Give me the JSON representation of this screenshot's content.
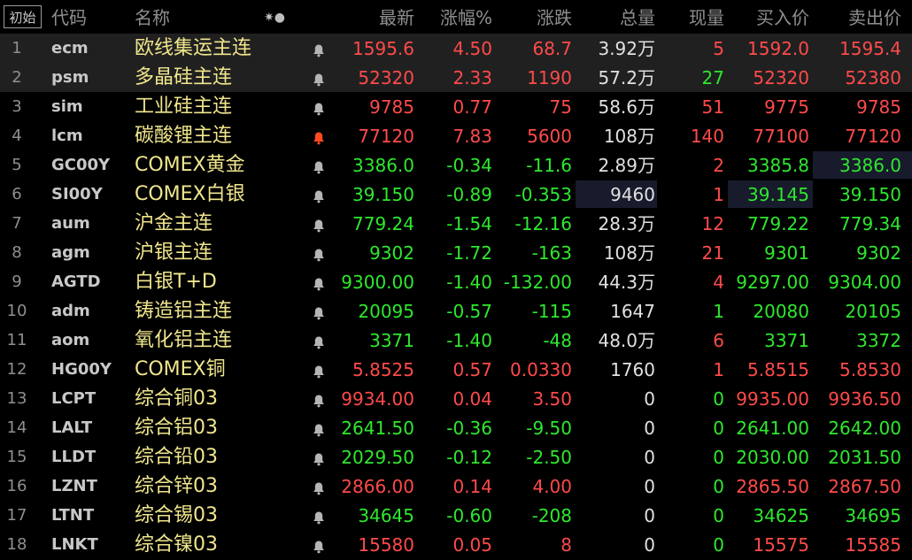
{
  "header": {
    "init_label": "初始",
    "columns": {
      "code": "代码",
      "name": "名称",
      "options_icon": "✷●",
      "last": "最新",
      "pct": "涨幅%",
      "chg": "涨跌",
      "vol": "总量",
      "cur": "现量",
      "bid": "买入价",
      "ask": "卖出价"
    }
  },
  "colors": {
    "up": "#ff4a4a",
    "down": "#2ee82e",
    "name": "#f0e68c",
    "bell_active": "#ff4b1f",
    "bell_inactive": "#b5b5b5"
  },
  "rows": [
    {
      "no": "1",
      "code": "ecm",
      "name": "欧线集运主连",
      "bell": "inactive",
      "last": "1595.6",
      "pct": "4.50",
      "chg": "68.7",
      "vol": "3.92万",
      "cur": "5",
      "bid": "1592.0",
      "ask": "1595.4",
      "dir": "up",
      "hl": true
    },
    {
      "no": "2",
      "code": "psm",
      "name": "多晶硅主连",
      "bell": "inactive",
      "last": "52320",
      "pct": "2.33",
      "chg": "1190",
      "vol": "57.2万",
      "cur": "27",
      "bid": "52320",
      "ask": "52380",
      "dir": "up",
      "cur_dir": "dn",
      "hl": true
    },
    {
      "no": "3",
      "code": "sim",
      "name": "工业硅主连",
      "bell": "inactive",
      "last": "9785",
      "pct": "0.77",
      "chg": "75",
      "vol": "58.6万",
      "cur": "51",
      "bid": "9775",
      "ask": "9785",
      "dir": "up"
    },
    {
      "no": "4",
      "code": "lcm",
      "name": "碳酸锂主连",
      "bell": "active",
      "last": "77120",
      "pct": "7.83",
      "chg": "5600",
      "vol": "108万",
      "cur": "140",
      "bid": "77100",
      "ask": "77120",
      "dir": "up"
    },
    {
      "no": "5",
      "code": "GC00Y",
      "name": "COMEX黄金",
      "bell": "inactive",
      "last": "3386.0",
      "pct": "-0.34",
      "chg": "-11.6",
      "vol": "2.89万",
      "cur": "2",
      "bid": "3385.8",
      "ask": "3386.0",
      "dir": "dn",
      "cur_dir": "up",
      "ask_box": true
    },
    {
      "no": "6",
      "code": "SI00Y",
      "name": "COMEX白银",
      "bell": "inactive",
      "last": "39.150",
      "pct": "-0.89",
      "chg": "-0.353",
      "vol": "9460",
      "cur": "1",
      "bid": "39.145",
      "ask": "39.150",
      "dir": "dn",
      "cur_dir": "up",
      "vol_box": true,
      "bid_box": true
    },
    {
      "no": "7",
      "code": "aum",
      "name": "沪金主连",
      "bell": "inactive",
      "last": "779.24",
      "pct": "-1.54",
      "chg": "-12.16",
      "vol": "28.3万",
      "cur": "12",
      "bid": "779.22",
      "ask": "779.34",
      "dir": "dn",
      "cur_dir": "up"
    },
    {
      "no": "8",
      "code": "agm",
      "name": "沪银主连",
      "bell": "inactive",
      "last": "9302",
      "pct": "-1.72",
      "chg": "-163",
      "vol": "108万",
      "cur": "21",
      "bid": "9301",
      "ask": "9302",
      "dir": "dn",
      "cur_dir": "up"
    },
    {
      "no": "9",
      "code": "AGTD",
      "name": "白银T+D",
      "bell": "inactive",
      "last": "9300.00",
      "pct": "-1.40",
      "chg": "-132.00",
      "vol": "44.3万",
      "cur": "4",
      "bid": "9297.00",
      "ask": "9304.00",
      "dir": "dn",
      "cur_dir": "up"
    },
    {
      "no": "10",
      "code": "adm",
      "name": "铸造铝主连",
      "bell": "inactive",
      "last": "20095",
      "pct": "-0.57",
      "chg": "-115",
      "vol": "1647",
      "cur": "1",
      "bid": "20080",
      "ask": "20105",
      "dir": "dn"
    },
    {
      "no": "11",
      "code": "aom",
      "name": "氧化铝主连",
      "bell": "inactive",
      "last": "3371",
      "pct": "-1.40",
      "chg": "-48",
      "vol": "48.0万",
      "cur": "6",
      "bid": "3371",
      "ask": "3372",
      "dir": "dn",
      "cur_dir": "up"
    },
    {
      "no": "12",
      "code": "HG00Y",
      "name": "COMEX铜",
      "bell": "inactive",
      "last": "5.8525",
      "pct": "0.57",
      "chg": "0.0330",
      "vol": "1760",
      "cur": "1",
      "bid": "5.8515",
      "ask": "5.8530",
      "dir": "up"
    },
    {
      "no": "13",
      "code": "LCPT",
      "name": "综合铜03",
      "bell": "inactive",
      "last": "9934.00",
      "pct": "0.04",
      "chg": "3.50",
      "vol": "0",
      "cur": "0",
      "bid": "9935.00",
      "ask": "9936.50",
      "dir": "up",
      "cur_dir": "dn"
    },
    {
      "no": "14",
      "code": "LALT",
      "name": "综合铝03",
      "bell": "inactive",
      "last": "2641.50",
      "pct": "-0.36",
      "chg": "-9.50",
      "vol": "0",
      "cur": "0",
      "bid": "2641.00",
      "ask": "2642.00",
      "dir": "dn"
    },
    {
      "no": "15",
      "code": "LLDT",
      "name": "综合铅03",
      "bell": "inactive",
      "last": "2029.50",
      "pct": "-0.12",
      "chg": "-2.50",
      "vol": "0",
      "cur": "0",
      "bid": "2030.00",
      "ask": "2031.50",
      "dir": "dn"
    },
    {
      "no": "16",
      "code": "LZNT",
      "name": "综合锌03",
      "bell": "inactive",
      "last": "2866.00",
      "pct": "0.14",
      "chg": "4.00",
      "vol": "0",
      "cur": "0",
      "bid": "2865.50",
      "ask": "2867.50",
      "dir": "up",
      "cur_dir": "dn"
    },
    {
      "no": "17",
      "code": "LTNT",
      "name": "综合锡03",
      "bell": "inactive",
      "last": "34645",
      "pct": "-0.60",
      "chg": "-208",
      "vol": "0",
      "cur": "0",
      "bid": "34625",
      "ask": "34695",
      "dir": "dn"
    },
    {
      "no": "18",
      "code": "LNKT",
      "name": "综合镍03",
      "bell": "inactive",
      "last": "15580",
      "pct": "0.05",
      "chg": "8",
      "vol": "0",
      "cur": "0",
      "bid": "15575",
      "ask": "15585",
      "dir": "up",
      "cur_dir": "dn"
    }
  ]
}
